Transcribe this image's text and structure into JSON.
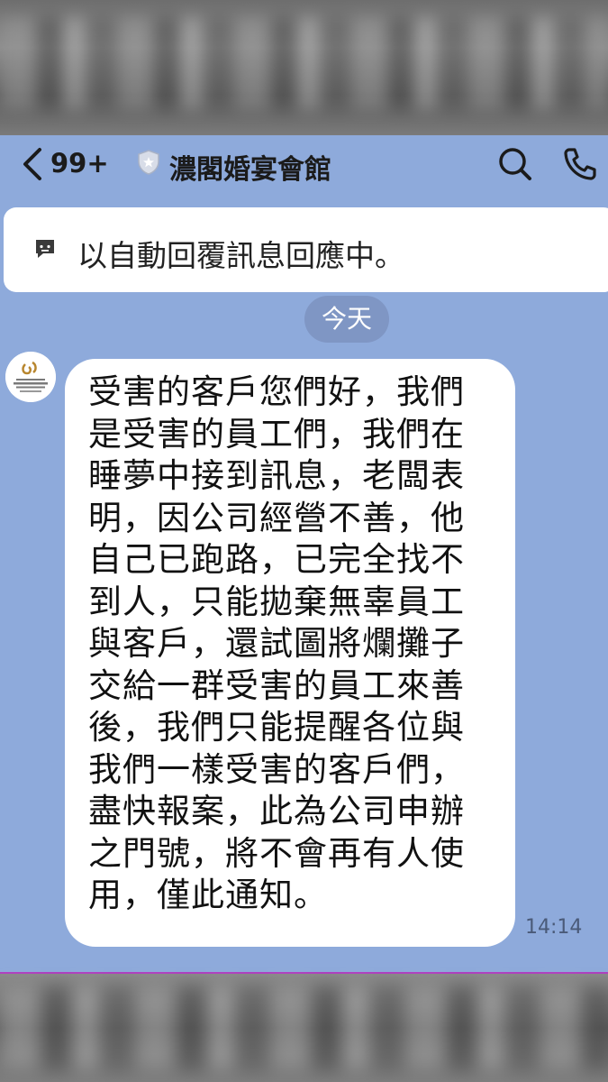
{
  "header": {
    "back_count": "99+",
    "title": "濃閣婚宴會館"
  },
  "auto_reply": {
    "text": "以自動回覆訊息回應中。"
  },
  "date_separator": "今天",
  "message": {
    "lines": [
      "受害的客戶您們好，我們",
      "是受害的員工們，我們在",
      "睡夢中接到訊息，老闆表",
      "明，因公司經營不善，他",
      "自己已跑路，已完全找不",
      "到人，只能拋棄無辜員工",
      "與客戶，還試圖將爛攤子",
      "交給一群受害的員工來善",
      "後，我們只能提醒各位與",
      "我們一樣受害的客戶們，",
      "盡快報案，此為公司申辦",
      "之門號，將不會再有人使",
      "用，僅此通知。"
    ],
    "time": "14:14"
  },
  "colors": {
    "chat_background": "#8eaadb",
    "date_pill": "#7f96c4",
    "bubble": "#ffffff"
  },
  "icons": [
    "back-chevron-icon",
    "shield-icon",
    "search-icon",
    "phone-icon",
    "auto-reply-icon",
    "avatar-logo"
  ]
}
